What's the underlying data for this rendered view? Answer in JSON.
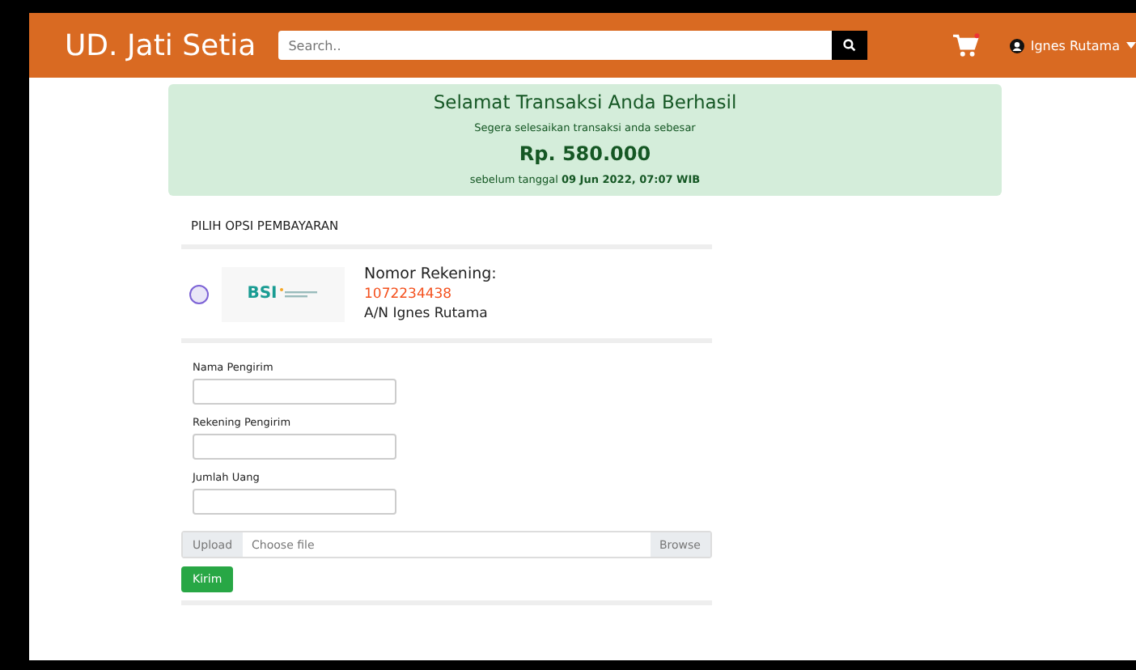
{
  "navbar": {
    "brand": "UD. Jati Setia",
    "search": {
      "placeholder": "Search.."
    },
    "user": "Ignes Rutama"
  },
  "alert": {
    "title": "Selamat Transaksi Anda Berhasil",
    "subtitle": "Segera selesaikan transaksi anda sebesar",
    "amount": "Rp. 580.000",
    "deadline": "sebelum tanggal **09 Jun 2022, 07:07 WIB**"
  },
  "payment": {
    "heading": "PILIH OPSI PEMBAYARAN",
    "options": [
      {
        "selected": false,
        "logo_text": "BSI",
        "label": "Nomor Rekening:",
        "account": "1072234438",
        "holder": "A/N Ignes Rutama"
      }
    ]
  },
  "form": {
    "fields": [
      {
        "label": "Nama Pengirim"
      },
      {
        "label": "Rekening Pengirim"
      },
      {
        "label": "Jumlah Uang"
      }
    ],
    "upload": {
      "prefix": "Upload",
      "placeholder": "Choose file",
      "browse": "Browse"
    },
    "submit": "Kirim"
  }
}
